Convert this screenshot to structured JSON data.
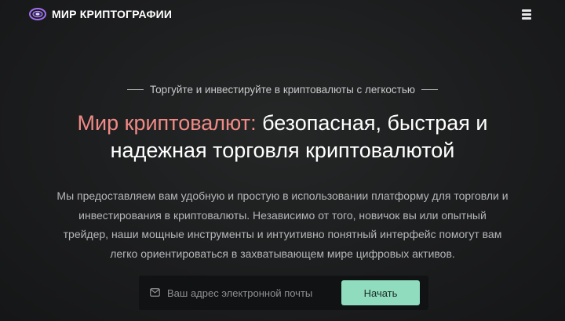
{
  "brand": {
    "name": "МИР КРИПТОГРАФИИ",
    "logo_icon": "crypto-logo-icon"
  },
  "nav": {
    "menu_icon": "hamburger-menu-icon"
  },
  "hero": {
    "eyebrow": "Торгуйте и инвестируйте в криптовалюты с легкостью",
    "headline_accent": "Мир криптовалют:",
    "headline_line1_rest": " безопасная, быстрая и",
    "headline_line2": "надежная торговля криптовалютой",
    "description_lines": [
      "Мы предоставляем вам удобную и простую в использовании платформу для торговли и",
      "инвестирования в криптовалюты. Независимо от того, новичок вы или опытный",
      "трейдер, наши мощные инструменты и интуитивно понятный интерфейс помогут вам",
      "легко ориентироваться в захватывающем мире цифровых активов."
    ]
  },
  "signup": {
    "email_value": "",
    "email_placeholder": "Ваш адрес электронной почты",
    "mail_icon": "mail-icon",
    "submit_label": "Начать"
  },
  "colors": {
    "accent": "#f08a86",
    "button": "#8fdcbf",
    "logo": "#a36ff5",
    "background": "#1c1d1e"
  }
}
